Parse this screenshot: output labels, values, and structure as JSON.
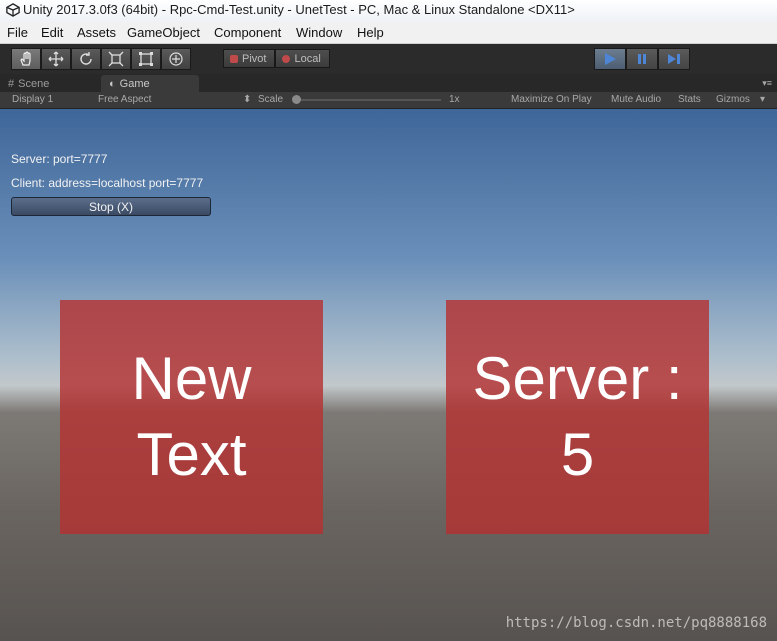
{
  "window": {
    "title": "Unity 2017.3.0f3 (64bit) - Rpc-Cmd-Test.unity - UnetTest - PC, Mac & Linux Standalone <DX11>"
  },
  "menu": [
    "File",
    "Edit",
    "Assets",
    "GameObject",
    "Component",
    "Window",
    "Help"
  ],
  "toolbar": {
    "tools": [
      "hand-tool",
      "move-tool",
      "rotate-tool",
      "scale-tool",
      "rect-tool",
      "transform-tool"
    ],
    "pivot_label": "Pivot",
    "local_label": "Local",
    "play_state": "playing"
  },
  "tabs": {
    "scene": "Scene",
    "game": "Game"
  },
  "game_bar": {
    "display": "Display 1",
    "aspect": "Free Aspect",
    "scale_label": "Scale",
    "scale_value": "1x",
    "maximize": "Maximize On Play",
    "mute": "Mute Audio",
    "stats": "Stats",
    "gizmos": "Gizmos"
  },
  "hud": {
    "server": "Server: port=7777",
    "client": "Client: address=localhost port=7777",
    "stop": "Stop (X)"
  },
  "panels": {
    "left_line1": "New",
    "left_line2": "Text",
    "right_line1": "Server :",
    "right_line2": "5"
  },
  "watermark": "https://blog.csdn.net/pq8888168",
  "colors": {
    "accent_play": "#4d86d6",
    "panel": "#b43232"
  }
}
